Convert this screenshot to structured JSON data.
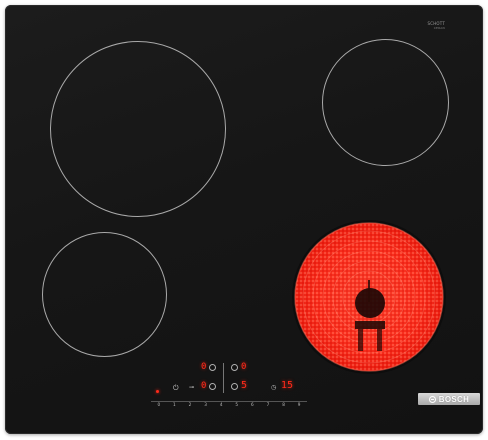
{
  "product": {
    "brand": "BOSCH",
    "badge_line1": "SCHOTT",
    "badge_line2": "CERAN",
    "model_text": ""
  },
  "zones": {
    "front_left": {
      "state": "off"
    },
    "rear_left": {
      "state": "off"
    },
    "rear_right": {
      "state": "off"
    },
    "front_right": {
      "state": "on",
      "glow_color": "#ff3b2a"
    }
  },
  "controls": {
    "display_rear_left": "0",
    "display_rear_right": "0",
    "display_front_left": "0",
    "display_front_right": "5",
    "timer_value": "15",
    "timer_icon": "clock-icon",
    "slider_steps": [
      "0",
      "1",
      "2",
      "3",
      "4",
      "5",
      "6",
      "7",
      "8",
      "9"
    ],
    "power_icon": "power-icon",
    "child_lock_icon": "key-icon"
  },
  "colors": {
    "glass": "#151515",
    "led": "#ff2a1a",
    "ring": "#a9a9a9",
    "logo_plate": "#bfbfbf"
  }
}
